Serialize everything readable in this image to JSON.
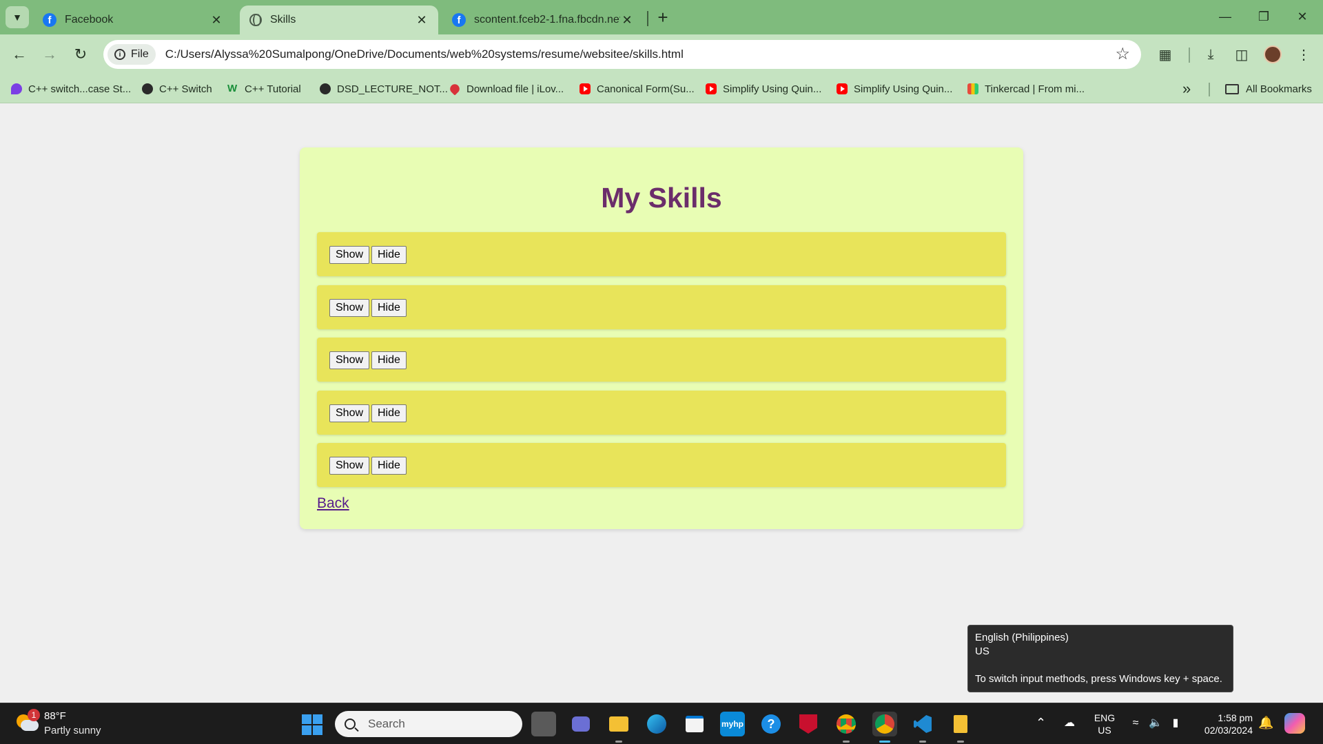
{
  "browser": {
    "tabs": [
      {
        "title": "Facebook",
        "icon": "facebook-icon",
        "active": false
      },
      {
        "title": "Skills",
        "icon": "globe-icon",
        "active": true
      },
      {
        "title": "scontent.fceb2-1.fna.fbcdn.net/",
        "icon": "facebook-icon",
        "active": false
      }
    ],
    "address": {
      "scheme_chip": "File",
      "url": "C:/Users/Alyssa%20Sumalpong/OneDrive/Documents/web%20systems/resume/websitee/skills.html"
    },
    "bookmarks": [
      {
        "label": "C++ switch...case St...",
        "icon": "purple-p-icon"
      },
      {
        "label": "C++ Switch",
        "icon": "globe-icon"
      },
      {
        "label": "C++ Tutorial",
        "icon": "w3schools-icon"
      },
      {
        "label": "DSD_LECTURE_NOT...",
        "icon": "globe-icon"
      },
      {
        "label": "Download file | iLov...",
        "icon": "heart-icon"
      },
      {
        "label": "Canonical Form(Su...",
        "icon": "youtube-icon"
      },
      {
        "label": "Simplify Using Quin...",
        "icon": "youtube-icon"
      },
      {
        "label": "Simplify Using Quin...",
        "icon": "youtube-icon"
      },
      {
        "label": "Tinkercad | From mi...",
        "icon": "tinkercad-icon"
      }
    ],
    "all_bookmarks": "All Bookmarks",
    "colors": {
      "frame": "#7fbb7d",
      "toolbar": "#c5e3c1"
    }
  },
  "page": {
    "title": "My Skills",
    "skills": [
      {
        "show_label": "Show",
        "hide_label": "Hide"
      },
      {
        "show_label": "Show",
        "hide_label": "Hide"
      },
      {
        "show_label": "Show",
        "hide_label": "Hide"
      },
      {
        "show_label": "Show",
        "hide_label": "Hide"
      },
      {
        "show_label": "Show",
        "hide_label": "Hide"
      }
    ],
    "back_link": "Back",
    "colors": {
      "card": "#e8fdb4",
      "row": "#e8e45a",
      "title": "#6b2d6b"
    }
  },
  "tooltip": {
    "line1": "English (Philippines)",
    "line2": "US",
    "line3": "To switch input methods, press Windows key + space."
  },
  "taskbar": {
    "weather": {
      "badge": "1",
      "temp": "88°F",
      "condition": "Partly sunny"
    },
    "search_placeholder": "Search",
    "language": {
      "lang": "ENG",
      "region": "US"
    },
    "clock": {
      "time": "1:58 pm",
      "date": "02/03/2024"
    }
  }
}
